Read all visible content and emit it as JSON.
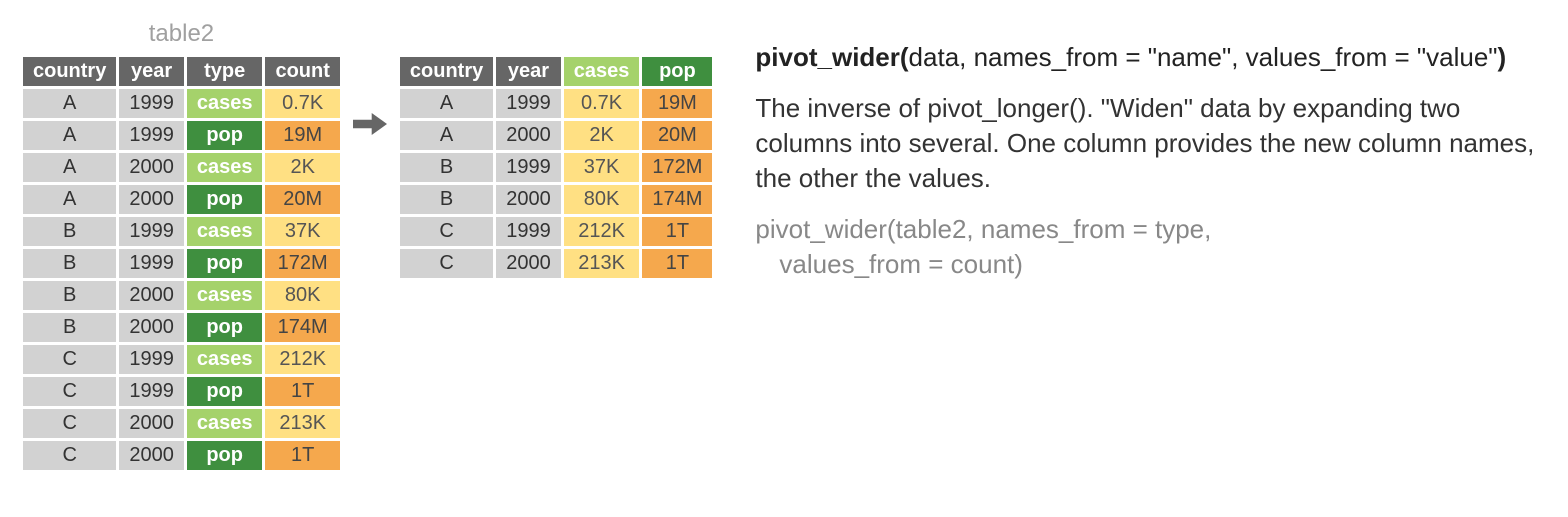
{
  "left_table": {
    "title": "table2",
    "headers": [
      "country",
      "year",
      "type",
      "count"
    ],
    "rows": [
      {
        "country": "A",
        "year": "1999",
        "type": "cases",
        "count": "0.7K"
      },
      {
        "country": "A",
        "year": "1999",
        "type": "pop",
        "count": "19M"
      },
      {
        "country": "A",
        "year": "2000",
        "type": "cases",
        "count": "2K"
      },
      {
        "country": "A",
        "year": "2000",
        "type": "pop",
        "count": "20M"
      },
      {
        "country": "B",
        "year": "1999",
        "type": "cases",
        "count": "37K"
      },
      {
        "country": "B",
        "year": "1999",
        "type": "pop",
        "count": "172M"
      },
      {
        "country": "B",
        "year": "2000",
        "type": "cases",
        "count": "80K"
      },
      {
        "country": "B",
        "year": "2000",
        "type": "pop",
        "count": "174M"
      },
      {
        "country": "C",
        "year": "1999",
        "type": "cases",
        "count": "212K"
      },
      {
        "country": "C",
        "year": "1999",
        "type": "pop",
        "count": "1T"
      },
      {
        "country": "C",
        "year": "2000",
        "type": "cases",
        "count": "213K"
      },
      {
        "country": "C",
        "year": "2000",
        "type": "pop",
        "count": "1T"
      }
    ]
  },
  "right_table": {
    "headers": [
      "country",
      "year",
      "cases",
      "pop"
    ],
    "rows": [
      {
        "country": "A",
        "year": "1999",
        "cases": "0.7K",
        "pop": "19M"
      },
      {
        "country": "A",
        "year": "2000",
        "cases": "2K",
        "pop": "20M"
      },
      {
        "country": "B",
        "year": "1999",
        "cases": "37K",
        "pop": "172M"
      },
      {
        "country": "B",
        "year": "2000",
        "cases": "80K",
        "pop": "174M"
      },
      {
        "country": "C",
        "year": "1999",
        "cases": "212K",
        "pop": "1T"
      },
      {
        "country": "C",
        "year": "2000",
        "cases": "213K",
        "pop": "1T"
      }
    ]
  },
  "doc": {
    "sig_bold1": "pivot_wider(",
    "sig_mid": "data, names_from = \"name\", values_from = \"value\"",
    "sig_bold2": ")",
    "desc": "The inverse of pivot_longer(). \"Widen\" data by expanding two columns into several. One column provides the new column names, the other the values.",
    "example_l1": "pivot_wider(table2, names_from = type,",
    "example_l2": "values_from = count)"
  }
}
